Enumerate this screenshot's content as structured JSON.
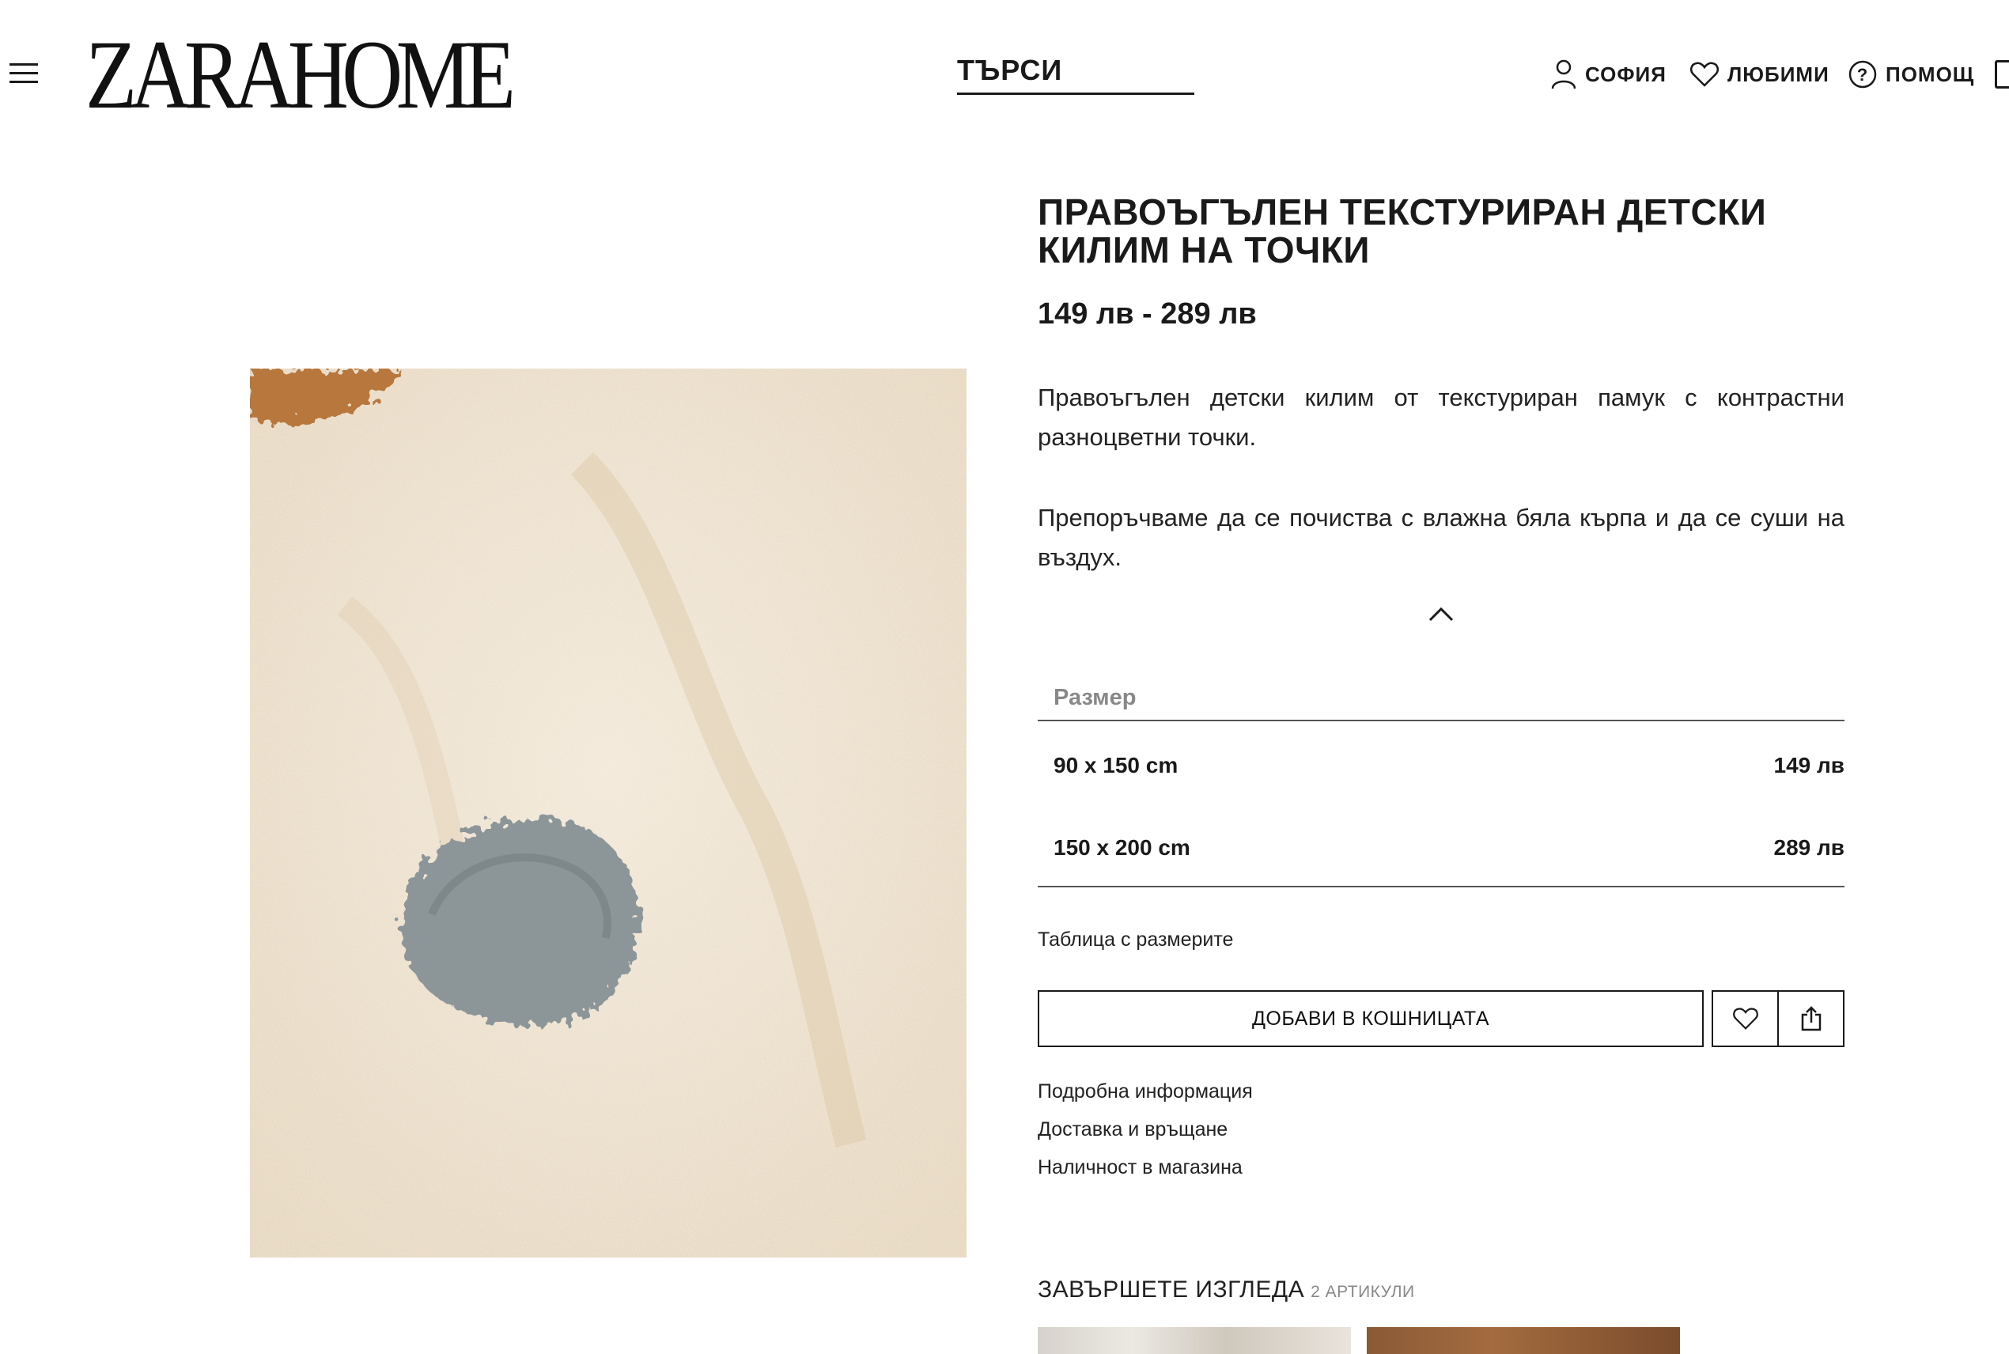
{
  "header": {
    "logo_text": "ZARAHOME",
    "search_label": "ТЪРСИ",
    "city_label": "СОФИЯ",
    "favorites_label": "ЛЮБИМИ",
    "help_label": "ПОМОЩ"
  },
  "product": {
    "title": "ПРАВОЪГЪЛЕН ТЕКСТУРИРАН ДЕТСКИ КИЛИМ НА ТОЧКИ",
    "price_range": "149 лв - 289 лв",
    "description": "Правоъгълен детски килим от текстуриран памук с контрастни разноцветни точки.",
    "care": "Препоръчваме да се почиства с влажна бяла кърпа и да се суши на въздух.",
    "size_label": "Размер",
    "sizes": [
      {
        "size": "90 x 150 cm",
        "price": "149 лв"
      },
      {
        "size": "150 x 200 cm",
        "price": "289 лв"
      }
    ],
    "size_table_link": "Таблица с размерите",
    "add_to_cart": "ДОБАВИ В КОШНИЦАТА",
    "info_links": [
      "Подробна информация",
      "Доставка и връщане",
      "Наличност в магазина"
    ]
  },
  "complete_look": {
    "title": "ЗАВЪРШЕТЕ ИЗГЛЕДА",
    "count": "2 АРТИКУЛИ"
  },
  "colors": {
    "text": "#1a1a1a",
    "muted": "#888888",
    "rug_base": "#efe3d0",
    "rug_dot_gray": "#8c9699",
    "rug_dot_brown": "#b7773c"
  }
}
